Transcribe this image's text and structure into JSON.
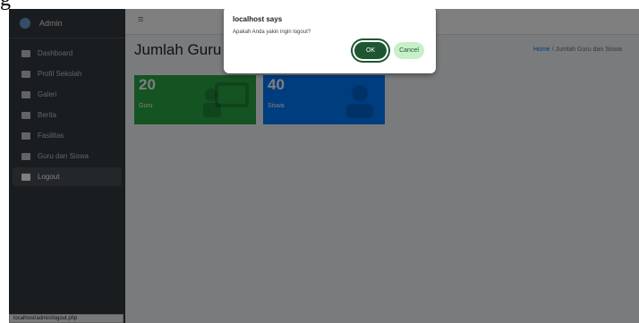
{
  "sidebar": {
    "brand": "Admin",
    "items": [
      {
        "label": "Dashboard",
        "icon": "tachometer-icon"
      },
      {
        "label": "Profil Sekolah",
        "icon": "school-icon"
      },
      {
        "label": "Galeri",
        "icon": "images-icon"
      },
      {
        "label": "Berita",
        "icon": "newspaper-icon"
      },
      {
        "label": "Fasilitas",
        "icon": "building-icon"
      },
      {
        "label": "Guru dan Siswa",
        "icon": "users-icon"
      },
      {
        "label": "Logout",
        "icon": "logout-icon",
        "active": true
      }
    ]
  },
  "navbar": {
    "menu_icon": "≡"
  },
  "content": {
    "title": "Jumlah Guru dan Siswa",
    "breadcrumb": {
      "home": "Home",
      "separator": "/",
      "current": "Jumlah Guru dan Siswa"
    },
    "cards": [
      {
        "count": "20",
        "label": "Guru",
        "color": "#28a745",
        "icon": "chalkboard-teacher-icon"
      },
      {
        "count": "40",
        "label": "Siswa",
        "color": "#007bff",
        "icon": "user-graduate-icon"
      }
    ]
  },
  "dialog": {
    "origin": "localhost says",
    "message": "Apakah Anda yakin ingin logout?",
    "ok_label": "OK",
    "cancel_label": "Cancel"
  },
  "statusbar": {
    "url": "localhost/admin/logout.php"
  },
  "corner_glyph": "g"
}
